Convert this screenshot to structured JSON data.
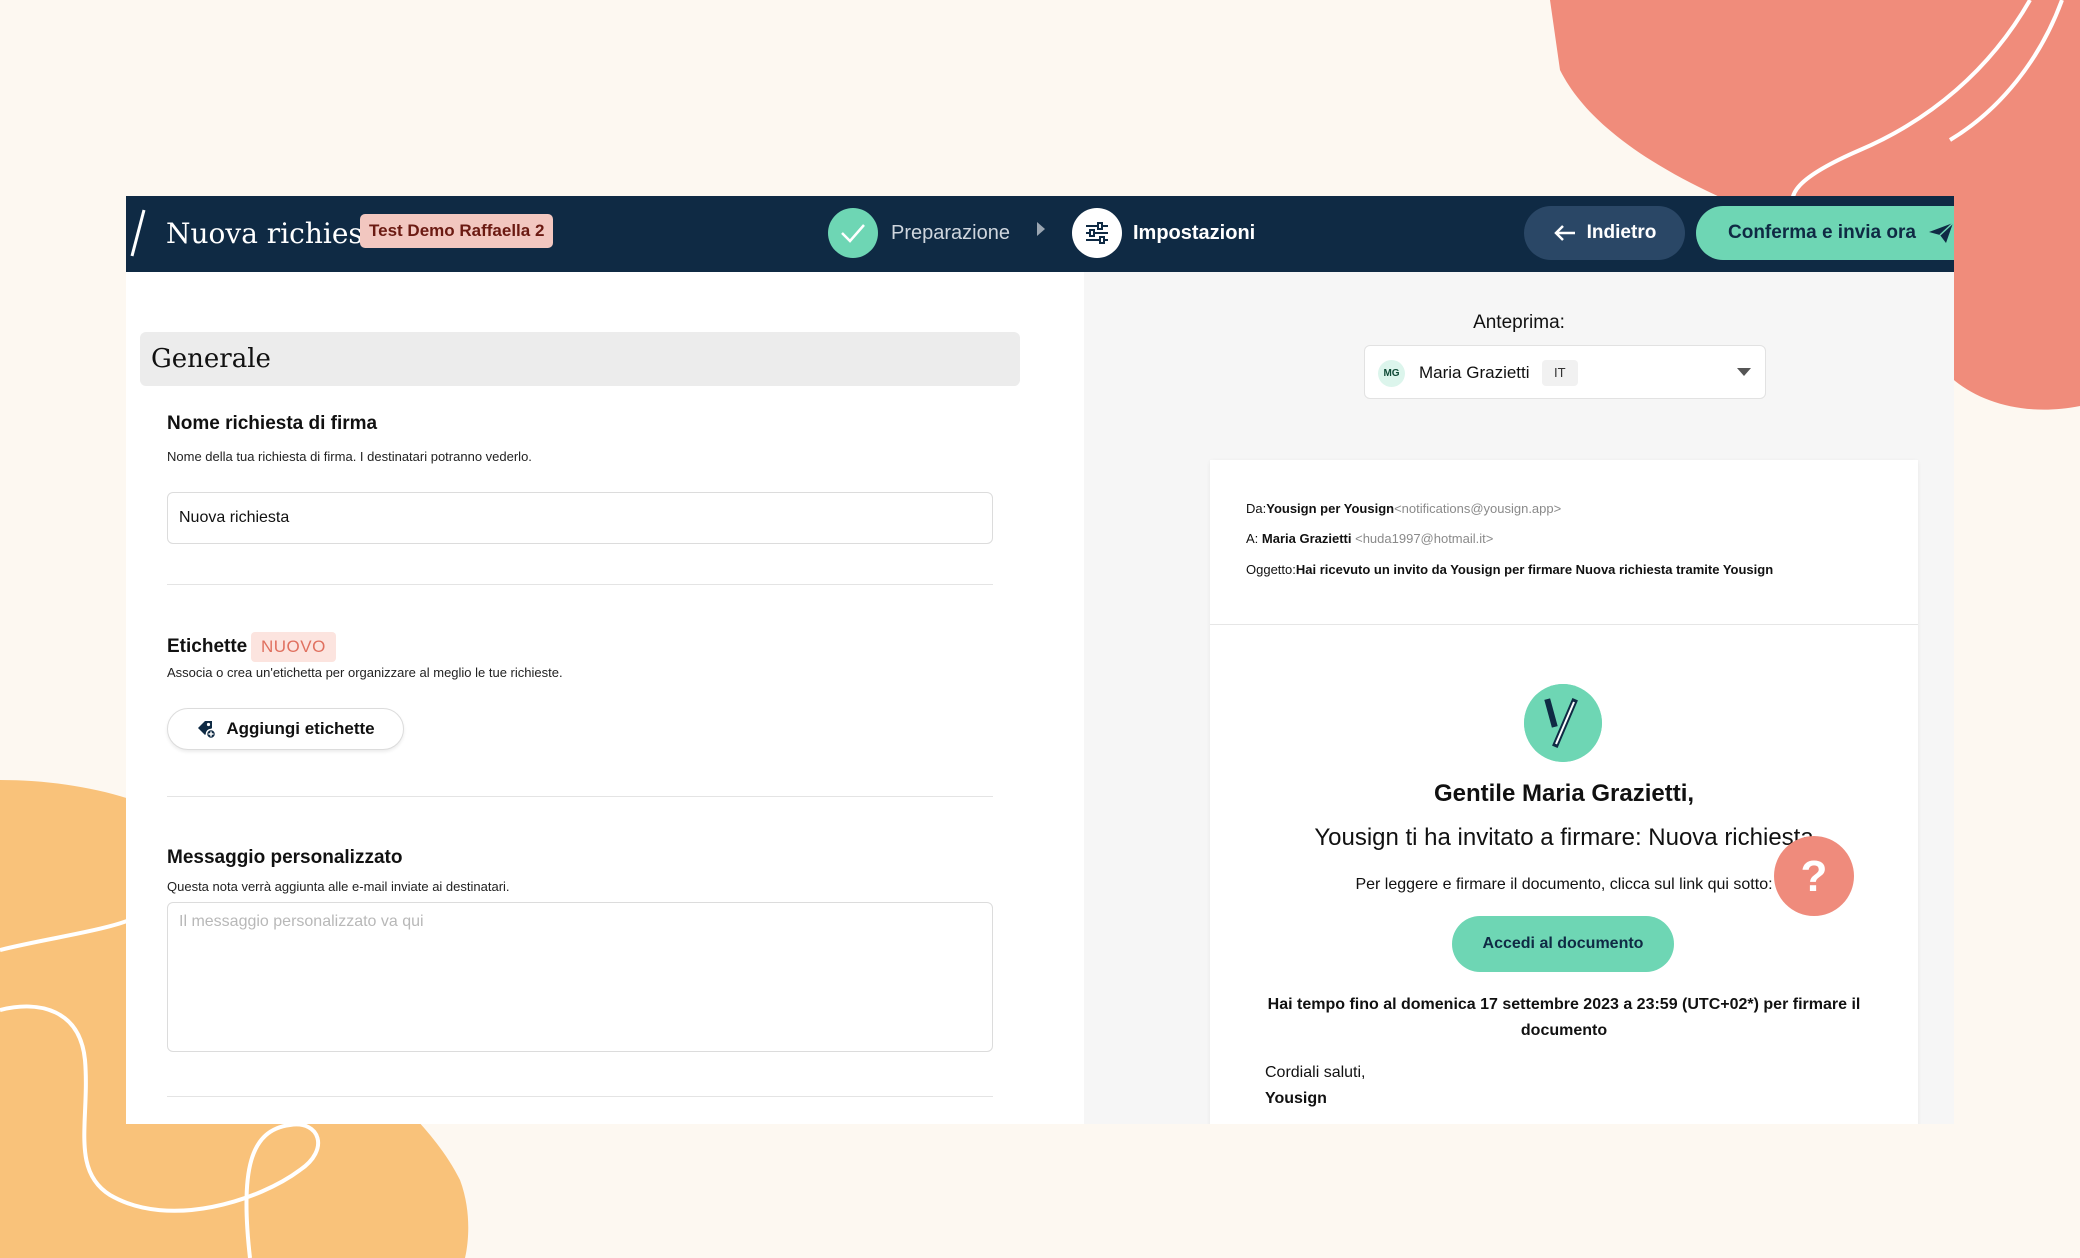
{
  "header": {
    "title": "Nuova richiesta",
    "badge": "Test Demo Raffaella 2",
    "steps": [
      {
        "label": "Preparazione",
        "status": "done"
      },
      {
        "label": "Impostazioni",
        "status": "current"
      }
    ],
    "back_label": "Indietro",
    "confirm_label": "Conferma e invia ora"
  },
  "left": {
    "section_title": "Generale",
    "name_field": {
      "title": "Nome richiesta di firma",
      "description": "Nome della tua richiesta di firma. I destinatari potranno vederlo.",
      "value": "Nuova richiesta"
    },
    "labels_field": {
      "title": "Etichette",
      "badge": "NUOVO",
      "description": "Associa o crea un'etichetta per organizzare al meglio le tue richieste.",
      "button": "Aggiungi etichette"
    },
    "message_field": {
      "title": "Messaggio personalizzato",
      "description": "Questa nota verrà aggiunta alle e-mail inviate ai destinatari.",
      "placeholder": "Il messaggio personalizzato va qui"
    }
  },
  "right": {
    "preview_label": "Anteprima:",
    "recipient": {
      "initials": "MG",
      "name": "Maria Grazietti",
      "lang": "IT"
    },
    "email": {
      "from_label": "Da:",
      "from_name": "Yousign per Yousign",
      "from_addr": "<notifications@yousign.app>",
      "to_label": "A: ",
      "to_name": "Maria Grazietti",
      "to_addr": " <huda1997@hotmail.it>",
      "subject_label": "Oggetto:",
      "subject": "Hai ricevuto un invito da Yousign per firmare Nuova richiesta tramite Yousign",
      "greeting": "Gentile Maria Grazietti,",
      "invite": "Yousign ti ha invitato a firmare: Nuova richiesta",
      "read_line": "Per leggere e firmare il documento, clicca sul link qui sotto:",
      "access_button": "Accedi al documento",
      "deadline": "Hai tempo fino al domenica 17 settembre 2023 a 23:59 (UTC+02*) per firmare il documento",
      "regards": "Cordiali saluti,",
      "signature": "Yousign"
    },
    "help": "?"
  },
  "colors": {
    "nav_bg": "#0f2a44",
    "accent": "#6ed6b4",
    "coral": "#ef8b7c",
    "badge_bg": "#f2c7c0"
  },
  "icons": [
    "check-icon",
    "settings-sliders-icon",
    "arrow-left-icon",
    "send-plane-icon",
    "tag-add-icon",
    "caret-down-icon",
    "yousign-logo"
  ]
}
